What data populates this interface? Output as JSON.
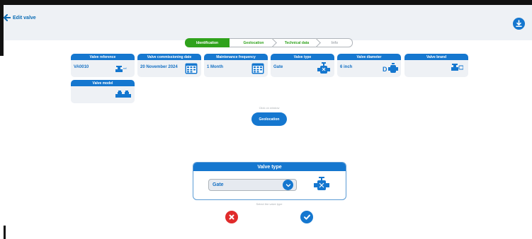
{
  "header": {
    "back_label": "Edit valve"
  },
  "steps": [
    {
      "label": "Identification"
    },
    {
      "label": "Geolocation"
    },
    {
      "label": "Technical data"
    },
    {
      "label": "Info"
    }
  ],
  "cards": {
    "reference": {
      "title": "Valve reference",
      "value": "VA0010",
      "icon": "valve-icon"
    },
    "commissioning": {
      "title": "Valve commissioning date",
      "value": "20 November 2024",
      "icon": "calendar-icon"
    },
    "frequency": {
      "title": "Maintenance frequency",
      "value": "1 Month",
      "icon": "calendar-icon"
    },
    "type": {
      "title": "Valve type",
      "value": "Gate",
      "icon": "valve-icon"
    },
    "diameter": {
      "title": "Valve diameter",
      "value": "6 inch",
      "icon": "diameter-valve-icon"
    },
    "brand": {
      "title": "Valve brand",
      "value": "",
      "icon": "valve-icon"
    },
    "model": {
      "title": "Valve model",
      "value": "",
      "icon": "valve-icon"
    }
  },
  "geo": {
    "hint": "Click on window",
    "button_label": "Geolocation"
  },
  "panel": {
    "title": "Valve type",
    "selected": "Gate",
    "hint": "Select the valve type"
  },
  "colors": {
    "primary": "#1577cf",
    "success": "#2fa21b",
    "danger": "#e02b2b",
    "card_bg": "#eef1f5"
  }
}
